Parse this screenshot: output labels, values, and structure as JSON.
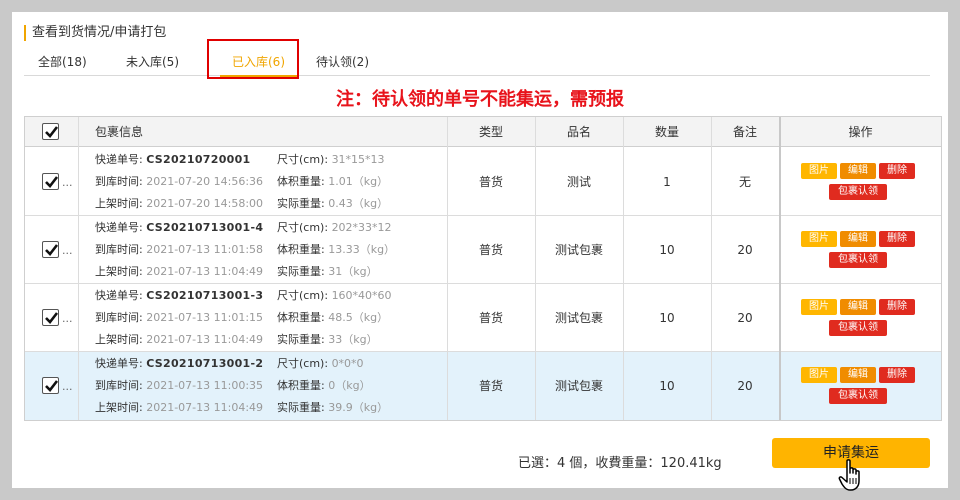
{
  "page_title": "查看到货情况/申请打包",
  "tabs": [
    {
      "label": "全部(18)"
    },
    {
      "label": "未入库(5)"
    },
    {
      "label": "已入库(6)"
    },
    {
      "label": "待认领(2)"
    }
  ],
  "notice": "注：待认领的单号不能集运，需预报",
  "table": {
    "headers": {
      "package_info": "包裹信息",
      "type": "类型",
      "name": "品名",
      "quantity": "数量",
      "remark": "备注",
      "actions": "操作"
    },
    "labels": {
      "tracking": "快递单号:",
      "size": "尺寸(cm):",
      "arrival": "到库时间:",
      "vol_weight": "体积重量:",
      "shelf": "上架时间:",
      "actual_weight": "实际重量:"
    },
    "buttons": {
      "image": "图片",
      "edit": "编辑",
      "delete": "删除",
      "claim": "包裹认领"
    },
    "ellipsis": "...",
    "rows": [
      {
        "tracking": "CS20210720001",
        "size": "31*15*13",
        "arrival": "2021-07-20 14:56:36",
        "vol_weight": "1.01（kg）",
        "shelf": "2021-07-20 14:58:00",
        "actual_weight": "0.43（kg）",
        "type": "普货",
        "name": "测试",
        "quantity": "1",
        "remark": "无",
        "checked": true
      },
      {
        "tracking": "CS20210713001-4",
        "size": "202*33*12",
        "arrival": "2021-07-13 11:01:58",
        "vol_weight": "13.33（kg）",
        "shelf": "2021-07-13 11:04:49",
        "actual_weight": "31（kg）",
        "type": "普货",
        "name": "测试包裹",
        "quantity": "10",
        "remark": "20",
        "checked": true
      },
      {
        "tracking": "CS20210713001-3",
        "size": "160*40*60",
        "arrival": "2021-07-13 11:01:15",
        "vol_weight": "48.5（kg）",
        "shelf": "2021-07-13 11:04:49",
        "actual_weight": "33（kg）",
        "type": "普货",
        "name": "测试包裹",
        "quantity": "10",
        "remark": "20",
        "checked": true
      },
      {
        "tracking": "CS20210713001-2",
        "size": "0*0*0",
        "arrival": "2021-07-13 11:00:35",
        "vol_weight": "0（kg）",
        "shelf": "2021-07-13 11:04:49",
        "actual_weight": "39.9（kg）",
        "type": "普货",
        "name": "测试包裹",
        "quantity": "10",
        "remark": "20",
        "checked": true,
        "selected": true
      }
    ]
  },
  "summary": "已選：4 個，收費重量：120.41kg",
  "apply_button": "申请集运",
  "colors": {
    "accent": "#f0a500",
    "notice_red": "#e8131b",
    "highlight_red": "#e00000",
    "button_yellow": "#ffb400",
    "button_red": "#e02b1f",
    "selected_row": "#e3f2fb"
  },
  "icons": {
    "checkbox": "checkmark-icon",
    "cursor": "hand-pointer-icon"
  }
}
